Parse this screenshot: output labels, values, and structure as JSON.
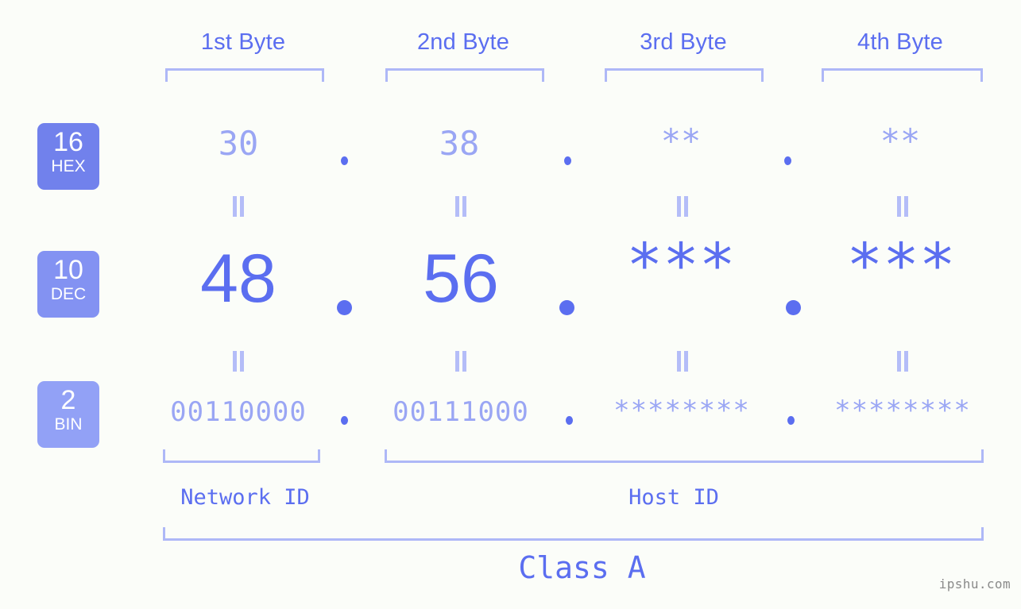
{
  "meta": {
    "bg_color": "#fbfdf9",
    "accent_strong": "#5b6ef0",
    "accent_light": "#9aa6f4",
    "bracket_color": "#aeb8f7",
    "watermark": "ipshu.com"
  },
  "headers": [
    {
      "label": "1st Byte"
    },
    {
      "label": "2nd Byte"
    },
    {
      "label": "3rd Byte"
    },
    {
      "label": "4th Byte"
    }
  ],
  "radix_badges": [
    {
      "num": "16",
      "name": "HEX",
      "color": "#7181ec"
    },
    {
      "num": "10",
      "name": "DEC",
      "color": "#8392f2"
    },
    {
      "num": "2",
      "name": "BIN",
      "color": "#92a1f6"
    }
  ],
  "rows": {
    "hex": {
      "radix": "16",
      "values": [
        "30",
        "38",
        "**",
        "**"
      ]
    },
    "dec": {
      "radix": "10",
      "values": [
        "48",
        "56",
        "***",
        "***"
      ]
    },
    "bin": {
      "radix": "2",
      "values": [
        "00110000",
        "00111000",
        "********",
        "********"
      ]
    }
  },
  "separators": {
    "symbol": "."
  },
  "equality": {
    "symbol": "="
  },
  "segments": [
    {
      "label": "Network ID"
    },
    {
      "label": "Host ID"
    }
  ],
  "class_label": "Class A",
  "chart_data": {
    "type": "table",
    "title": "IP address byte breakdown",
    "columns": [
      "1st Byte",
      "2nd Byte",
      "3rd Byte",
      "4th Byte"
    ],
    "rows": [
      {
        "radix": "16",
        "radix_name": "HEX",
        "cells": [
          "30",
          "38",
          "**",
          "**"
        ]
      },
      {
        "radix": "10",
        "radix_name": "DEC",
        "cells": [
          "48",
          "56",
          "***",
          "***"
        ]
      },
      {
        "radix": "2",
        "radix_name": "BIN",
        "cells": [
          "00110000",
          "00111000",
          "********",
          "********"
        ]
      }
    ],
    "network_id_bytes": 1,
    "host_id_bytes": 3,
    "ip_class": "Class A"
  }
}
